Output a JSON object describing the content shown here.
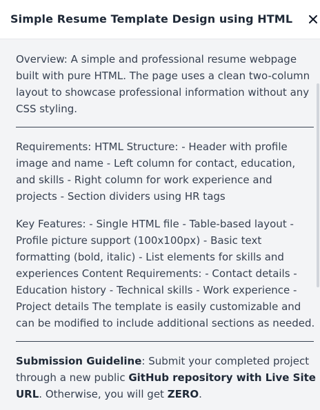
{
  "modal": {
    "title": "Simple Resume Template Design using HTML",
    "close_icon": "close-icon"
  },
  "content": {
    "overview": "Overview: A simple and professional resume webpage built with pure HTML. The page uses a clean two-column layout to showcase professional information without any CSS styling.",
    "requirements": "Requirements: HTML Structure: - Header with profile image and name - Left column for contact, education, and skills - Right column for work experience and projects - Section dividers using HR tags",
    "key_features": "Key Features: - Single HTML file - Table-based layout - Profile picture support (100x100px) - Basic text formatting (bold, italic) - List elements for skills and experiences Content Requirements: - Contact details - Education history - Technical skills - Work experience - Project details The template is easily customizable and can be modified to include additional sections as needed.",
    "guideline": {
      "label": "Submission Guideline",
      "text_1": ": Submit your completed project through a new public ",
      "bold_1": "GitHub repository with Live Site URL",
      "text_2": ". Otherwise, you will get ",
      "bold_2": "ZERO",
      "text_3": "."
    }
  },
  "colors": {
    "background": "#f3f4f6",
    "text": "#374151",
    "title": "#1f2937"
  }
}
